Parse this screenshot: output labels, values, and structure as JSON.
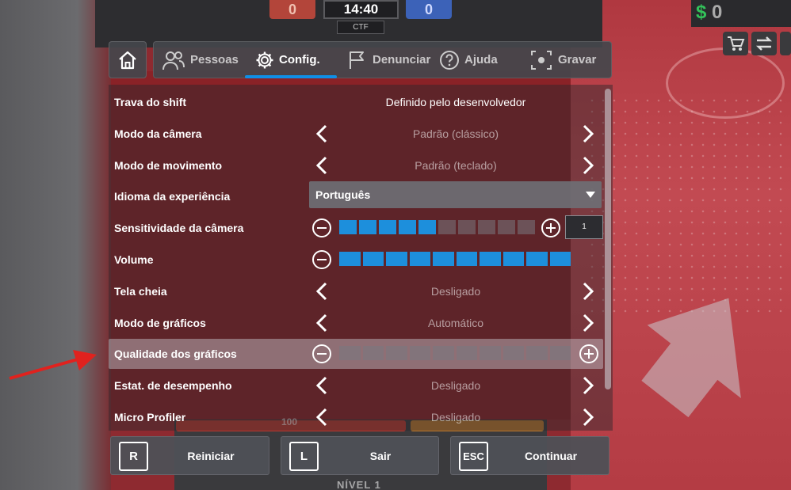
{
  "hud": {
    "score_red": "0",
    "timer": "14:40",
    "score_blue": "0",
    "mode": "CTF",
    "cash_symbol": "$",
    "cash_value": "0",
    "health_value": "100",
    "level_label": "NÍVEL 1"
  },
  "tabs": [
    {
      "label": "Pessoas",
      "icon": "people-icon"
    },
    {
      "label": "Config.",
      "icon": "gear-icon",
      "active": true
    },
    {
      "label": "Denunciar",
      "icon": "flag-icon"
    },
    {
      "label": "Ajuda",
      "icon": "help-icon"
    },
    {
      "label": "Gravar",
      "icon": "record-icon"
    }
  ],
  "settings": [
    {
      "label": "Trava do shift",
      "value": "Definido pelo desenvolvedor"
    },
    {
      "label": "Modo da câmera",
      "value": "Padrão (clássico)"
    },
    {
      "label": "Modo de movimento",
      "value": "Padrão (teclado)"
    },
    {
      "label": "Idioma da experiência",
      "value": "Português"
    },
    {
      "label": "Sensitividade da câmera",
      "value": "1",
      "level": 5,
      "max": 10
    },
    {
      "label": "Volume",
      "level": 10,
      "max": 10
    },
    {
      "label": "Tela cheia",
      "value": "Desligado"
    },
    {
      "label": "Modo de gráficos",
      "value": "Automático"
    },
    {
      "label": "Qualidade dos gráficos",
      "level": 0,
      "max": 10
    },
    {
      "label": "Estat. de desempenho",
      "value": "Desligado"
    },
    {
      "label": "Micro Profiler",
      "value": "Desligado"
    }
  ],
  "buttons": [
    {
      "key": "R",
      "label": "Reiniciar"
    },
    {
      "key": "L",
      "label": "Sair"
    },
    {
      "key": "ESC",
      "label": "Continuar"
    }
  ],
  "colors": {
    "accent": "#0f8fe6",
    "slider_on": "#1d8fdc",
    "highlight_row": "#cdcdd2",
    "annotation_arrow": "#e0221e"
  }
}
